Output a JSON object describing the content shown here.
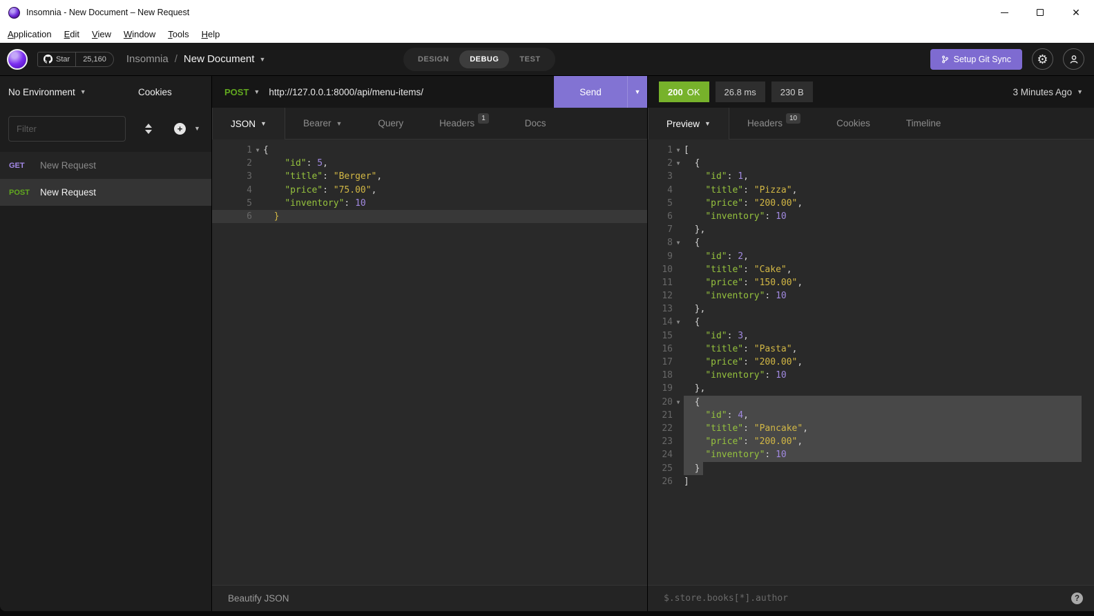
{
  "window": {
    "title": "Insomnia - New Document – New Request"
  },
  "menu": {
    "items": [
      "Application",
      "Edit",
      "View",
      "Window",
      "Tools",
      "Help"
    ]
  },
  "topbar": {
    "star_label": "Star",
    "star_count": "25,160",
    "breadcrumb_app": "Insomnia",
    "breadcrumb_sep": "/",
    "breadcrumb_doc": "New Document",
    "mode_tabs": [
      "DESIGN",
      "DEBUG",
      "TEST"
    ],
    "active_mode": "DEBUG",
    "git_sync_label": "Setup Git Sync"
  },
  "sidebar": {
    "environment_label": "No Environment",
    "cookies_label": "Cookies",
    "filter_placeholder": "Filter",
    "requests": [
      {
        "method": "GET",
        "name": "New Request"
      },
      {
        "method": "POST",
        "name": "New Request"
      }
    ]
  },
  "request": {
    "method": "POST",
    "url": "http://127.0.0.1:8000/api/menu-items/",
    "send_label": "Send",
    "tabs": {
      "body": "JSON",
      "auth": "Bearer",
      "query": "Query",
      "headers": "Headers",
      "docs": "Docs"
    },
    "headers_count": "1",
    "beautify_label": "Beautify JSON",
    "body_lines": [
      {
        "n": 1,
        "fold": true,
        "tokens": [
          {
            "t": "p",
            "v": "{"
          }
        ]
      },
      {
        "n": 2,
        "tokens": [
          {
            "t": "p",
            "v": "    "
          },
          {
            "t": "k",
            "v": "\"id\""
          },
          {
            "t": "p",
            "v": ": "
          },
          {
            "t": "n",
            "v": "5"
          },
          {
            "t": "p",
            "v": ","
          }
        ]
      },
      {
        "n": 3,
        "tokens": [
          {
            "t": "p",
            "v": "    "
          },
          {
            "t": "k",
            "v": "\"title\""
          },
          {
            "t": "p",
            "v": ": "
          },
          {
            "t": "s",
            "v": "\"Berger\""
          },
          {
            "t": "p",
            "v": ","
          }
        ]
      },
      {
        "n": 4,
        "tokens": [
          {
            "t": "p",
            "v": "    "
          },
          {
            "t": "k",
            "v": "\"price\""
          },
          {
            "t": "p",
            "v": ": "
          },
          {
            "t": "s",
            "v": "\"75.00\""
          },
          {
            "t": "p",
            "v": ","
          }
        ]
      },
      {
        "n": 5,
        "tokens": [
          {
            "t": "p",
            "v": "    "
          },
          {
            "t": "k",
            "v": "\"inventory\""
          },
          {
            "t": "p",
            "v": ": "
          },
          {
            "t": "n",
            "v": "10"
          }
        ]
      },
      {
        "n": 6,
        "cls": "active",
        "tokens": [
          {
            "t": "p",
            "v": "  "
          },
          {
            "t": "m",
            "v": "}"
          }
        ]
      }
    ]
  },
  "response": {
    "status_code": "200",
    "status_text": "OK",
    "time": "26.8 ms",
    "size": "230 B",
    "history_label": "3 Minutes Ago",
    "tabs": {
      "preview": "Preview",
      "headers": "Headers",
      "cookies": "Cookies",
      "timeline": "Timeline"
    },
    "headers_count": "10",
    "filter_placeholder": "$.store.books[*].author",
    "body_lines": [
      {
        "n": 1,
        "fold": true,
        "tokens": [
          {
            "t": "p",
            "v": "["
          }
        ]
      },
      {
        "n": 2,
        "fold": true,
        "tokens": [
          {
            "t": "p",
            "v": "  {"
          }
        ]
      },
      {
        "n": 3,
        "tokens": [
          {
            "t": "p",
            "v": "    "
          },
          {
            "t": "k",
            "v": "\"id\""
          },
          {
            "t": "p",
            "v": ": "
          },
          {
            "t": "n",
            "v": "1"
          },
          {
            "t": "p",
            "v": ","
          }
        ]
      },
      {
        "n": 4,
        "tokens": [
          {
            "t": "p",
            "v": "    "
          },
          {
            "t": "k",
            "v": "\"title\""
          },
          {
            "t": "p",
            "v": ": "
          },
          {
            "t": "s",
            "v": "\"Pizza\""
          },
          {
            "t": "p",
            "v": ","
          }
        ]
      },
      {
        "n": 5,
        "tokens": [
          {
            "t": "p",
            "v": "    "
          },
          {
            "t": "k",
            "v": "\"price\""
          },
          {
            "t": "p",
            "v": ": "
          },
          {
            "t": "s",
            "v": "\"200.00\""
          },
          {
            "t": "p",
            "v": ","
          }
        ]
      },
      {
        "n": 6,
        "tokens": [
          {
            "t": "p",
            "v": "    "
          },
          {
            "t": "k",
            "v": "\"inventory\""
          },
          {
            "t": "p",
            "v": ": "
          },
          {
            "t": "n",
            "v": "10"
          }
        ]
      },
      {
        "n": 7,
        "tokens": [
          {
            "t": "p",
            "v": "  },"
          }
        ]
      },
      {
        "n": 8,
        "fold": true,
        "tokens": [
          {
            "t": "p",
            "v": "  {"
          }
        ]
      },
      {
        "n": 9,
        "tokens": [
          {
            "t": "p",
            "v": "    "
          },
          {
            "t": "k",
            "v": "\"id\""
          },
          {
            "t": "p",
            "v": ": "
          },
          {
            "t": "n",
            "v": "2"
          },
          {
            "t": "p",
            "v": ","
          }
        ]
      },
      {
        "n": 10,
        "tokens": [
          {
            "t": "p",
            "v": "    "
          },
          {
            "t": "k",
            "v": "\"title\""
          },
          {
            "t": "p",
            "v": ": "
          },
          {
            "t": "s",
            "v": "\"Cake\""
          },
          {
            "t": "p",
            "v": ","
          }
        ]
      },
      {
        "n": 11,
        "tokens": [
          {
            "t": "p",
            "v": "    "
          },
          {
            "t": "k",
            "v": "\"price\""
          },
          {
            "t": "p",
            "v": ": "
          },
          {
            "t": "s",
            "v": "\"150.00\""
          },
          {
            "t": "p",
            "v": ","
          }
        ]
      },
      {
        "n": 12,
        "tokens": [
          {
            "t": "p",
            "v": "    "
          },
          {
            "t": "k",
            "v": "\"inventory\""
          },
          {
            "t": "p",
            "v": ": "
          },
          {
            "t": "n",
            "v": "10"
          }
        ]
      },
      {
        "n": 13,
        "tokens": [
          {
            "t": "p",
            "v": "  },"
          }
        ]
      },
      {
        "n": 14,
        "fold": true,
        "tokens": [
          {
            "t": "p",
            "v": "  {"
          }
        ]
      },
      {
        "n": 15,
        "tokens": [
          {
            "t": "p",
            "v": "    "
          },
          {
            "t": "k",
            "v": "\"id\""
          },
          {
            "t": "p",
            "v": ": "
          },
          {
            "t": "n",
            "v": "3"
          },
          {
            "t": "p",
            "v": ","
          }
        ]
      },
      {
        "n": 16,
        "tokens": [
          {
            "t": "p",
            "v": "    "
          },
          {
            "t": "k",
            "v": "\"title\""
          },
          {
            "t": "p",
            "v": ": "
          },
          {
            "t": "s",
            "v": "\"Pasta\""
          },
          {
            "t": "p",
            "v": ","
          }
        ]
      },
      {
        "n": 17,
        "tokens": [
          {
            "t": "p",
            "v": "    "
          },
          {
            "t": "k",
            "v": "\"price\""
          },
          {
            "t": "p",
            "v": ": "
          },
          {
            "t": "s",
            "v": "\"200.00\""
          },
          {
            "t": "p",
            "v": ","
          }
        ]
      },
      {
        "n": 18,
        "tokens": [
          {
            "t": "p",
            "v": "    "
          },
          {
            "t": "k",
            "v": "\"inventory\""
          },
          {
            "t": "p",
            "v": ": "
          },
          {
            "t": "n",
            "v": "10"
          }
        ]
      },
      {
        "n": 19,
        "tokens": [
          {
            "t": "p",
            "v": "  },"
          }
        ]
      },
      {
        "n": 20,
        "fold": true,
        "cls": "sel",
        "tokens": [
          {
            "t": "p",
            "v": "  {"
          }
        ]
      },
      {
        "n": 21,
        "cls": "sel",
        "tokens": [
          {
            "t": "p",
            "v": "    "
          },
          {
            "t": "k",
            "v": "\"id\""
          },
          {
            "t": "p",
            "v": ": "
          },
          {
            "t": "n",
            "v": "4"
          },
          {
            "t": "p",
            "v": ","
          }
        ]
      },
      {
        "n": 22,
        "cls": "sel",
        "tokens": [
          {
            "t": "p",
            "v": "    "
          },
          {
            "t": "k",
            "v": "\"title\""
          },
          {
            "t": "p",
            "v": ": "
          },
          {
            "t": "s",
            "v": "\"Pancake\""
          },
          {
            "t": "p",
            "v": ","
          }
        ]
      },
      {
        "n": 23,
        "cls": "sel",
        "tokens": [
          {
            "t": "p",
            "v": "    "
          },
          {
            "t": "k",
            "v": "\"price\""
          },
          {
            "t": "p",
            "v": ": "
          },
          {
            "t": "s",
            "v": "\"200.00\""
          },
          {
            "t": "p",
            "v": ","
          }
        ]
      },
      {
        "n": 24,
        "cls": "sel",
        "tokens": [
          {
            "t": "p",
            "v": "    "
          },
          {
            "t": "k",
            "v": "\"inventory\""
          },
          {
            "t": "p",
            "v": ": "
          },
          {
            "t": "n",
            "v": "10"
          }
        ]
      },
      {
        "n": 25,
        "cls": "sel-partial",
        "tokens": [
          {
            "t": "p",
            "v": "  }"
          }
        ]
      },
      {
        "n": 26,
        "tokens": [
          {
            "t": "p",
            "v": "]"
          }
        ]
      }
    ]
  },
  "colors": {
    "accent": "#7e6bd1",
    "success": "#77b22b",
    "method_get": "#a489e8",
    "method_post": "#62a91f"
  }
}
